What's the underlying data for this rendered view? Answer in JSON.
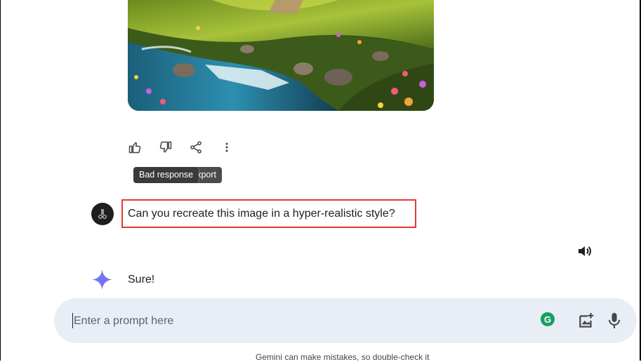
{
  "image": {
    "alt": "landscape-illustration"
  },
  "toolbar": {
    "good_response": "thumb-up-icon",
    "bad_response": "thumb-down-icon",
    "share": "share-icon",
    "more": "more-vertical-icon"
  },
  "tooltips": {
    "bad_response": "Bad response",
    "share_export": "d export"
  },
  "conversation": {
    "user_prompt": "Can you recreate this image in a hyper-realistic style?",
    "model_reply": "Sure!"
  },
  "input": {
    "placeholder": "Enter a prompt here",
    "value": ""
  },
  "disclaimer": "Gemini can make mistakes, so double-check it",
  "colors": {
    "highlight_border": "#e53935",
    "input_bg": "#e9eef6",
    "grammarly": "#15a063",
    "tooltip_bg": "#3a3a3a"
  }
}
